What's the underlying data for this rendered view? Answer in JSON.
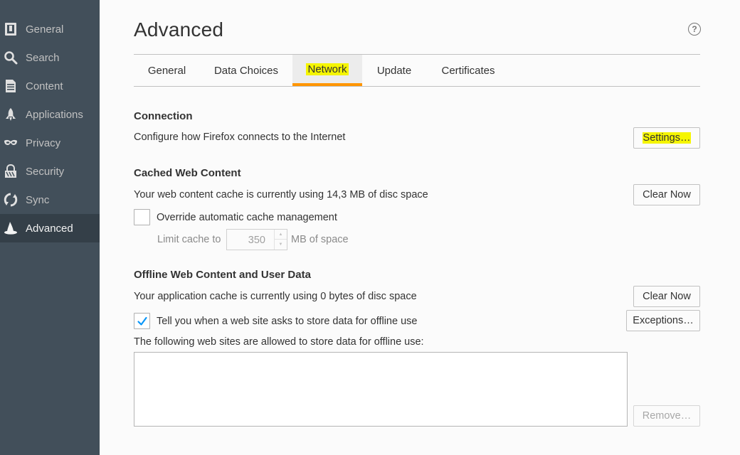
{
  "sidebar": {
    "items": [
      {
        "label": "General",
        "icon": "general-icon"
      },
      {
        "label": "Search",
        "icon": "search-icon"
      },
      {
        "label": "Content",
        "icon": "content-icon"
      },
      {
        "label": "Applications",
        "icon": "applications-icon"
      },
      {
        "label": "Privacy",
        "icon": "privacy-mask-icon"
      },
      {
        "label": "Security",
        "icon": "security-icon"
      },
      {
        "label": "Sync",
        "icon": "sync-icon"
      },
      {
        "label": "Advanced",
        "icon": "advanced-wizard-hat-icon",
        "selected": true
      }
    ]
  },
  "header": {
    "title": "Advanced",
    "help_icon": "?"
  },
  "tabs": [
    {
      "label": "General"
    },
    {
      "label": "Data Choices"
    },
    {
      "label": "Network",
      "selected": true
    },
    {
      "label": "Update"
    },
    {
      "label": "Certificates"
    }
  ],
  "connection": {
    "title": "Connection",
    "description": "Configure how Firefox connects to the Internet",
    "settings_button": "Settings…"
  },
  "cached_content": {
    "title": "Cached Web Content",
    "description": "Your web content cache is currently using 14,3 MB of disc space",
    "clear_button": "Clear Now",
    "override_label": "Override automatic cache management",
    "override_checked": false,
    "limit_label": "Limit cache to",
    "limit_value": "350",
    "limit_unit": "MB of space"
  },
  "offline_content": {
    "title": "Offline Web Content and User Data",
    "description": "Your application cache is currently using 0 bytes of disc space",
    "clear_button": "Clear Now",
    "tell_label": "Tell you when a web site asks to store data for offline use",
    "tell_checked": true,
    "exceptions_button": "Exceptions…",
    "allowed_label": "The following web sites are allowed to store data for offline use:",
    "remove_button": "Remove…"
  },
  "colors": {
    "sidebar_bg": "#424f5a",
    "sidebar_selected_bg": "#343f48",
    "tab_accent": "#ff9500",
    "highlight": "#f5f500",
    "check_blue": "#0996f8"
  }
}
